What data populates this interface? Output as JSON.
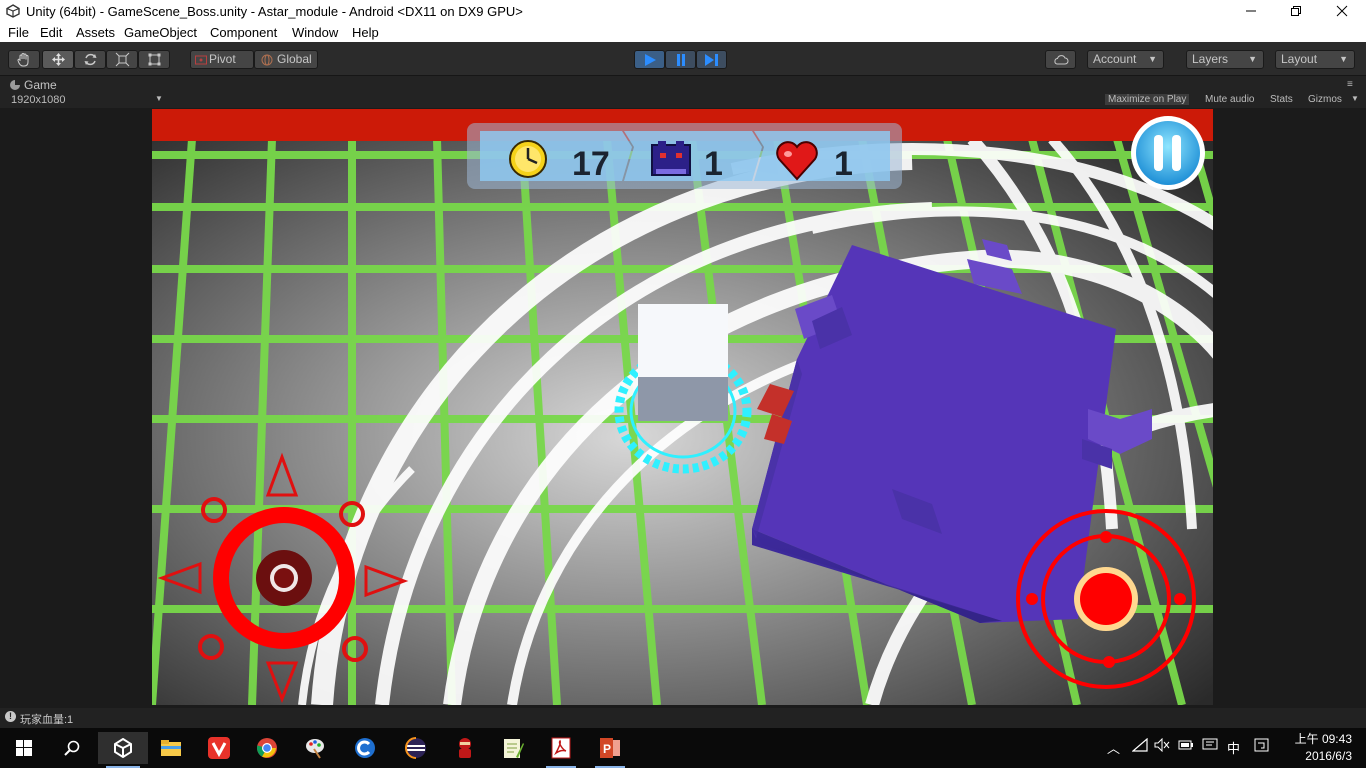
{
  "window": {
    "title": "Unity (64bit) - GameScene_Boss.unity - Astar_module - Android <DX11 on DX9 GPU>",
    "minimize_icon": "minimize-icon",
    "restore_icon": "restore-icon",
    "close_icon": "close-icon"
  },
  "menu": [
    "File",
    "Edit",
    "Assets",
    "GameObject",
    "Component",
    "Window",
    "Help"
  ],
  "toolbar": {
    "tools": [
      "hand-icon",
      "move-icon",
      "rotate-icon",
      "scale-icon",
      "rect-tool-icon"
    ],
    "pivot_label": "Pivot",
    "global_label": "Global",
    "play_state": "playing",
    "account_label": "Account",
    "layers_label": "Layers",
    "layout_label": "Layout"
  },
  "game_view": {
    "tab_label": "Game",
    "resolution": "1920x1080",
    "options": [
      "Maximize on Play",
      "Mute audio",
      "Stats",
      "Gizmos"
    ],
    "active_option": "Maximize on Play"
  },
  "hud": {
    "time_value": "17",
    "boss_count": "1",
    "lives": "1",
    "colors": {
      "top_bar": "#cc1a08",
      "grid": "#78d84a",
      "boss": "#5535b8",
      "player_ring": "#2ff0ff",
      "controls": "#ff0000"
    }
  },
  "status": {
    "message": "玩家血量:1"
  },
  "taskbar": {
    "apps": [
      "unity-icon",
      "file-explorer-icon",
      "vivaldi-icon",
      "chrome-icon",
      "paint-icon",
      "ccleaner-icon",
      "eclipse-icon",
      "ninja-icon",
      "notepad-plus-plus-icon",
      "acrobat-icon",
      "powerpoint-icon"
    ],
    "time": "上午 09:43",
    "date": "2016/6/3",
    "ime": "中"
  }
}
